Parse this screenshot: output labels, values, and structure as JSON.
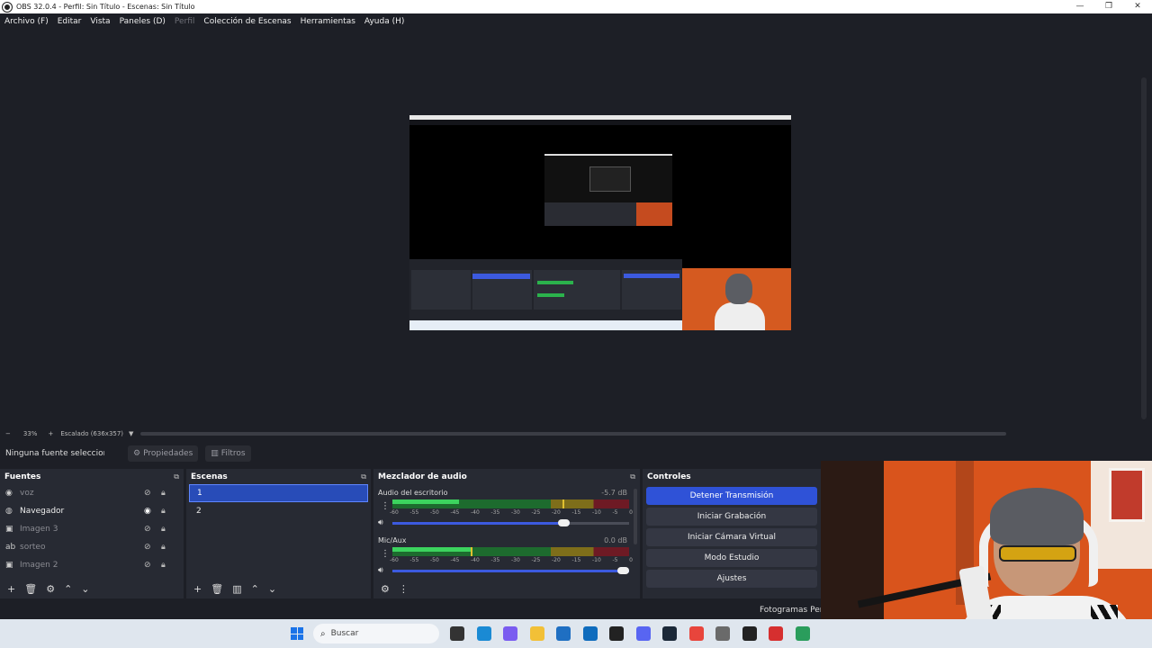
{
  "window": {
    "title": "OBS 32.0.4 - Perfil: Sin Título - Escenas: Sin Título",
    "buttons": [
      "—",
      "❐",
      "✕"
    ]
  },
  "menu": {
    "items": [
      {
        "label": "Archivo (F)",
        "enabled": true
      },
      {
        "label": "Editar",
        "enabled": true
      },
      {
        "label": "Vista",
        "enabled": true
      },
      {
        "label": "Paneles (D)",
        "enabled": true
      },
      {
        "label": "Perfil",
        "enabled": false
      },
      {
        "label": "Colección de Escenas",
        "enabled": true
      },
      {
        "label": "Herramientas",
        "enabled": true
      },
      {
        "label": "Ayuda (H)",
        "enabled": true
      }
    ]
  },
  "zoom": {
    "minus": "−",
    "value": "33%",
    "plus": "+",
    "mode": "Escalado (636x357)",
    "dropdown": "▼"
  },
  "source_toolbar": {
    "no_source": "Ninguna fuente seleccionada",
    "properties": "Propiedades",
    "filters": "Filtros"
  },
  "sources": {
    "title": "Fuentes",
    "items": [
      {
        "label": "voz",
        "icon": "audio-icon",
        "visible": false
      },
      {
        "label": "Navegador",
        "icon": "browser-icon",
        "visible": true
      },
      {
        "label": "Imagen 3",
        "icon": "image-icon",
        "visible": false
      },
      {
        "label": "sorteo",
        "icon": "text-icon",
        "visible": false
      },
      {
        "label": "Imagen 2",
        "icon": "image-icon",
        "visible": false
      }
    ]
  },
  "scenes": {
    "title": "Escenas",
    "items": [
      {
        "label": "1",
        "active": true
      },
      {
        "label": "2",
        "active": false
      }
    ]
  },
  "mixer": {
    "title": "Mezclador de audio",
    "scale": [
      "-60",
      "-55",
      "-50",
      "-45",
      "-40",
      "-35",
      "-30",
      "-25",
      "-20",
      "-15",
      "-10",
      "-5",
      "0"
    ],
    "channels": [
      {
        "name": "Audio del escritorio",
        "db": "-5.7 dB",
        "level": 0.28,
        "peak": 0.72,
        "volume": 0.75
      },
      {
        "name": "Mic/Aux",
        "db": "0.0 dB",
        "level": 0.33,
        "peak": 0.33,
        "volume": 1.0
      }
    ]
  },
  "controls": {
    "title": "Controles",
    "buttons": [
      {
        "label": "Detener Transmisión",
        "primary": true
      },
      {
        "label": "Iniciar Grabación",
        "primary": false
      },
      {
        "label": "Iniciar Cámara Virtual",
        "primary": false
      },
      {
        "label": "Modo Estudio",
        "primary": false
      },
      {
        "label": "Ajustes",
        "primary": false
      }
    ]
  },
  "status": {
    "dropped_frames": "Fotogramas Perd"
  },
  "taskbar": {
    "search_placeholder": "Buscar",
    "icons": [
      {
        "name": "task-view-icon",
        "color": "#333333"
      },
      {
        "name": "edge-icon",
        "color": "#1a8ad4"
      },
      {
        "name": "copilot-icon",
        "color": "#7a5cf0"
      },
      {
        "name": "file-explorer-icon",
        "color": "#f2c037"
      },
      {
        "name": "store-icon",
        "color": "#1f6fc2"
      },
      {
        "name": "outlook-icon",
        "color": "#0f6cbd"
      },
      {
        "name": "sticky-notes-icon",
        "color": "#222222"
      },
      {
        "name": "discord-icon",
        "color": "#5865f2"
      },
      {
        "name": "steam-icon",
        "color": "#1b2838"
      },
      {
        "name": "chrome-icon",
        "color": "#e8453c"
      },
      {
        "name": "settings-icon",
        "color": "#6a6a6a"
      },
      {
        "name": "obs-icon",
        "color": "#222222"
      },
      {
        "name": "recorder-icon",
        "color": "#d62f2f"
      },
      {
        "name": "greenshot-icon",
        "color": "#2a9d5c"
      }
    ]
  },
  "colors": {
    "accent": "#2f52d7",
    "panel": "#272a33",
    "background": "#1d1f26"
  }
}
